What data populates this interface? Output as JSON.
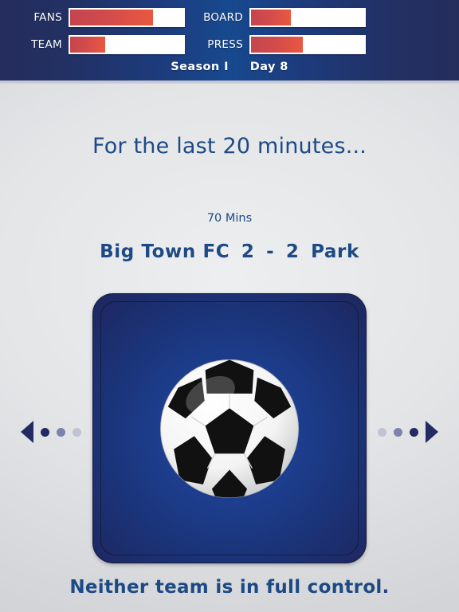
{
  "header": {
    "meters": [
      {
        "label": "FANS",
        "value": 73,
        "column": "left",
        "row": 0
      },
      {
        "label": "TEAM",
        "value": 31,
        "column": "left",
        "row": 1
      },
      {
        "label": "BOARD",
        "value": 35,
        "column": "right",
        "row": 0
      },
      {
        "label": "PRESS",
        "value": 46,
        "column": "right",
        "row": 1
      }
    ],
    "season": "Season I",
    "day": "Day 8",
    "colors": {
      "bar_fill_start": "#c4454e",
      "bar_fill_end": "#e9583f",
      "bar_track": "#ffffff",
      "header_edge": "#252d5c",
      "header_center": "#17498f",
      "label_text": "#ffffff"
    }
  },
  "main": {
    "headline": "For the last 20 minutes...",
    "match_time": "70 Mins",
    "score": {
      "home_team": "Big Town FC",
      "home_score": "2",
      "separator": "-",
      "away_score": "2",
      "away_team": "Park",
      "full_line": "Big Town FC  2  -  2  Park"
    },
    "panel": {
      "icon": "soccer-ball-icon",
      "background_color": "#1d3f90"
    },
    "footer_text": "Neither team is in full control.",
    "text_color": "#1d4a84"
  },
  "nav": {
    "left_arrow": "triangle-left-icon",
    "right_arrow": "triangle-right-icon",
    "dot_count": 3,
    "dot_colors": [
      "#222b63",
      "#7b82ab",
      "#c0c3d3"
    ]
  }
}
